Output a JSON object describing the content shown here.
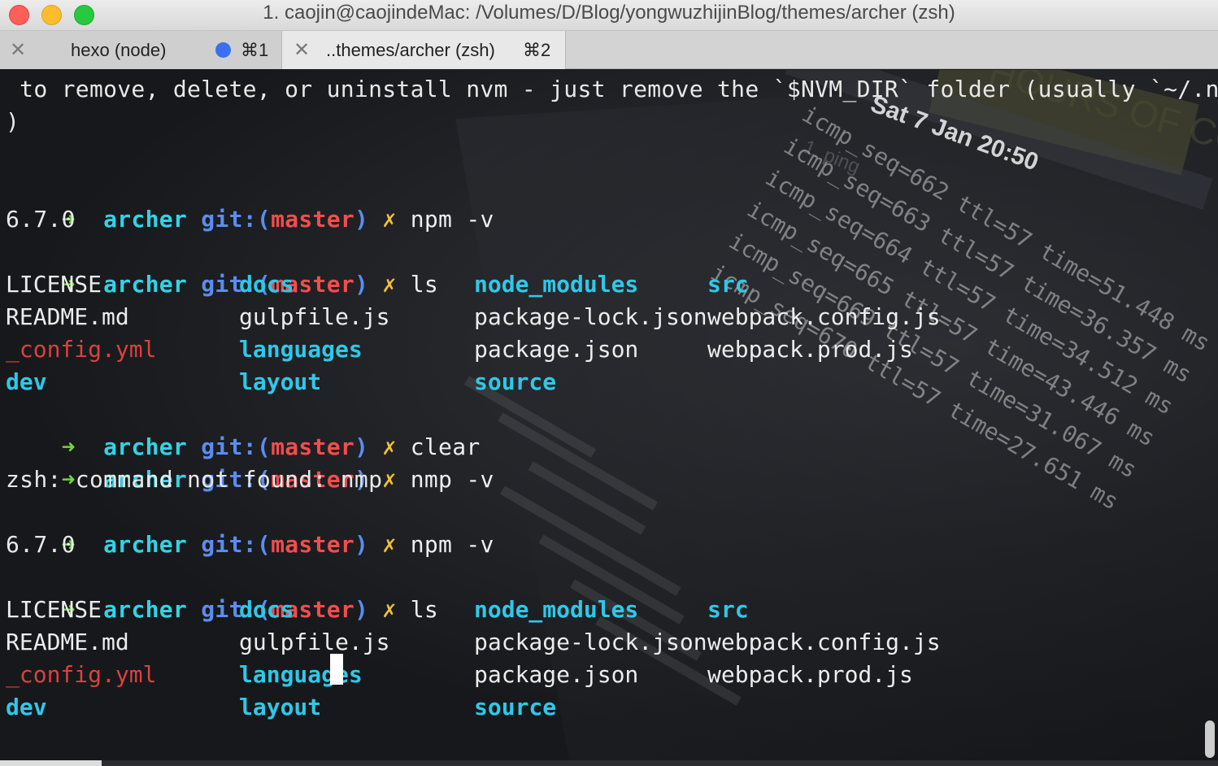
{
  "window": {
    "title": "1. caojin@caojindeMac: /Volumes/D/Blog/yongwuzhijinBlog/themes/archer (zsh)"
  },
  "tabs": [
    {
      "label": "hexo (node)",
      "shortcut": "⌘1",
      "close": "✕"
    },
    {
      "label": "..themes/archer (zsh)",
      "shortcut": "⌘2",
      "close": "✕"
    }
  ],
  "prompt": {
    "arrow": "➜",
    "dir": "archer",
    "git": "git:",
    "open_paren": "(",
    "branch": "master",
    "close_paren": ")",
    "dirty": "✗"
  },
  "output": {
    "nvm_line": " to remove, delete, or uninstall nvm - just remove the `$NVM_DIR` folder (usually `~/.nvm`",
    "nvm_line_end": ")",
    "cmd_npm_v": "npm -v",
    "npm_version": "6.7.0",
    "cmd_ls": "ls",
    "cmd_clear": "clear",
    "cmd_nmp_v": "nmp -v",
    "not_found": "zsh: command not found: nmp"
  },
  "ls_listing": {
    "col1": [
      "LICENSE",
      "README.md",
      "_config.yml",
      "dev"
    ],
    "col2": [
      "docs",
      "gulpfile.js",
      "languages",
      "layout"
    ],
    "col3": [
      "node_modules",
      "package-lock.json",
      "package.json",
      "source"
    ],
    "col4": [
      "src",
      "webpack.config.js",
      "webpack.prod.js"
    ]
  },
  "background_photo": {
    "status_bar": "Sat 7 Jan 20:50",
    "sticky_note": "HOURS OF CODE",
    "window_title": "1. ping",
    "ping_rows": [
      "icmp_seq=662 ttl=57 time=51.448 ms",
      "icmp_seq=663 ttl=57 time=36.357 ms",
      "icmp_seq=664 ttl=57 time=34.512 ms",
      "icmp_seq=665 ttl=57 time=43.446 ms",
      "icmp_seq=669 ttl=57 time=31.067 ms",
      "icmp_seq=670 ttl=57 time=27.651 ms"
    ]
  },
  "colors": {
    "prompt_arrow": "#6fd63b",
    "dir": "#33d2e6",
    "git": "#5b8df0",
    "branch": "#f24d4d",
    "dirty": "#f1c232",
    "folder": "#2fc8e8",
    "hidden_file": "#d9423f"
  }
}
